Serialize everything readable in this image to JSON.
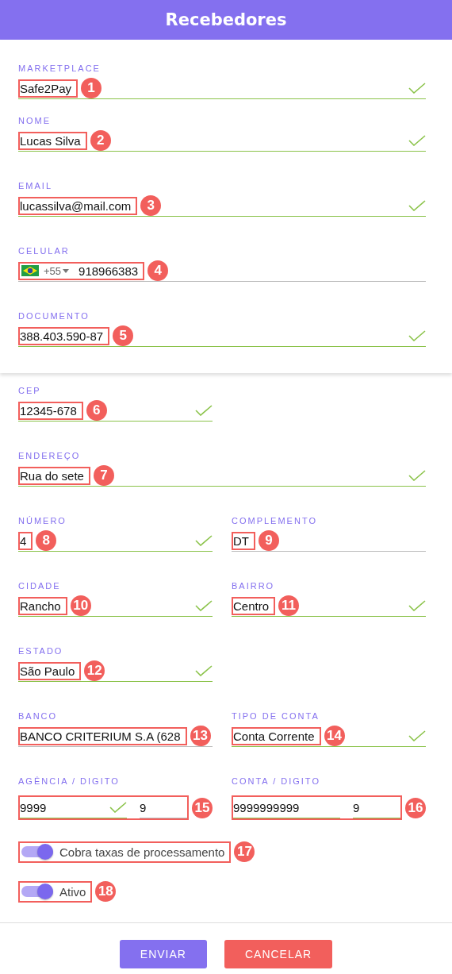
{
  "header": {
    "title": "Recebedores"
  },
  "card_rows": [
    [
      {
        "kind": "text",
        "label": "MARKETPLACE",
        "value": "Safe2Pay",
        "valid": true,
        "marker": "1"
      }
    ],
    [
      {
        "kind": "text",
        "label": "NOME",
        "value": "Lucas Silva",
        "valid": true,
        "marker": "2"
      }
    ],
    [
      {
        "kind": "text",
        "label": "EMAIL",
        "value": "lucassilva@mail.com",
        "valid": true,
        "marker": "3"
      }
    ],
    [
      {
        "kind": "phone",
        "label": "CELULAR",
        "country_code": "+55",
        "value": "918966383",
        "valid": false,
        "marker": "4"
      }
    ],
    [
      {
        "kind": "text",
        "label": "DOCUMENTO",
        "value": "388.403.590-87",
        "valid": true,
        "marker": "5"
      }
    ]
  ],
  "rows": [
    [
      {
        "kind": "text",
        "label": "CEP",
        "value": "12345-678",
        "valid": true,
        "marker": "6"
      },
      {
        "kind": "empty"
      }
    ],
    [
      {
        "kind": "text",
        "label": "ENDEREÇO",
        "value": "Rua do sete",
        "valid": true,
        "marker": "7"
      }
    ],
    [
      {
        "kind": "text",
        "label": "NÚMERO",
        "value": "4",
        "valid": true,
        "marker": "8"
      },
      {
        "kind": "text",
        "label": "COMPLEMENTO",
        "value": "DT",
        "valid": false,
        "marker": "9"
      }
    ],
    [
      {
        "kind": "text",
        "label": "CIDADE",
        "value": "Rancho",
        "valid": true,
        "marker": "10"
      },
      {
        "kind": "text",
        "label": "BAIRRO",
        "value": "Centro",
        "valid": true,
        "marker": "11"
      }
    ],
    [
      {
        "kind": "text",
        "label": "ESTADO",
        "value": "São Paulo",
        "valid": true,
        "marker": "12"
      },
      {
        "kind": "empty"
      }
    ],
    [
      {
        "kind": "text",
        "label": "BANCO",
        "value": "BANCO CRITERIUM S.A (628",
        "valid": false,
        "marker": "13"
      },
      {
        "kind": "text",
        "label": "TIPO DE CONTA",
        "value": "Conta Corrente",
        "valid": true,
        "marker": "14"
      }
    ],
    [
      {
        "kind": "split",
        "label": "AGÊNCIA / DIGITO",
        "value": "9999",
        "digit": "9",
        "valid": true,
        "marker": "15"
      },
      {
        "kind": "split",
        "label": "CONTA / DIGITO",
        "value": "9999999999",
        "digit": "9",
        "valid": false,
        "marker": "16"
      }
    ]
  ],
  "toggles": [
    {
      "label": "Cobra taxas de processamento",
      "on": true,
      "marker": "17"
    },
    {
      "label": "Ativo",
      "on": true,
      "marker": "18"
    }
  ],
  "buttons": [
    {
      "label": "ENVIAR",
      "kind": "primary"
    },
    {
      "label": "CANCELAR",
      "kind": "danger"
    }
  ]
}
